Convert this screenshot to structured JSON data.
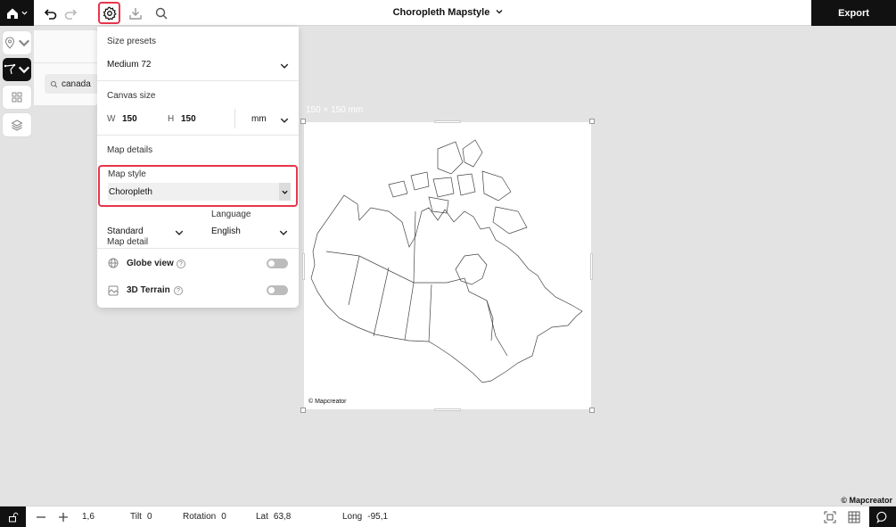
{
  "header": {
    "title": "Choropleth Mapstyle",
    "export_label": "Export"
  },
  "search": {
    "value": "canada"
  },
  "settings": {
    "size_presets_label": "Size presets",
    "size_presets_value": "Medium 72",
    "canvas_size_label": "Canvas size",
    "width_label": "W",
    "width_value": "150",
    "height_label": "H",
    "height_value": "150",
    "unit_value": "mm",
    "map_details_label": "Map details",
    "map_style_label": "Map style",
    "map_style_value": "Choropleth",
    "map_detail_label": "Map detail",
    "map_detail_value": "Standard",
    "language_label": "Language",
    "language_value": "English",
    "globe_view_label": "Globe view",
    "terrain_label": "3D Terrain"
  },
  "canvas": {
    "size_label": "150 × 150 mm",
    "attribution": "© Mapcreator"
  },
  "corner_attribution": "© Mapcreator",
  "statusbar": {
    "zoom": "1,6",
    "tilt_label": "Tilt",
    "tilt_value": "0",
    "rotation_label": "Rotation",
    "rotation_value": "0",
    "lat_label": "Lat",
    "lat_value": "63,8",
    "long_label": "Long",
    "long_value": "-95,1"
  },
  "colors": {
    "accent_red": "#e6364c",
    "dark": "#111111",
    "canvas_bg": "#e3e3e3"
  }
}
